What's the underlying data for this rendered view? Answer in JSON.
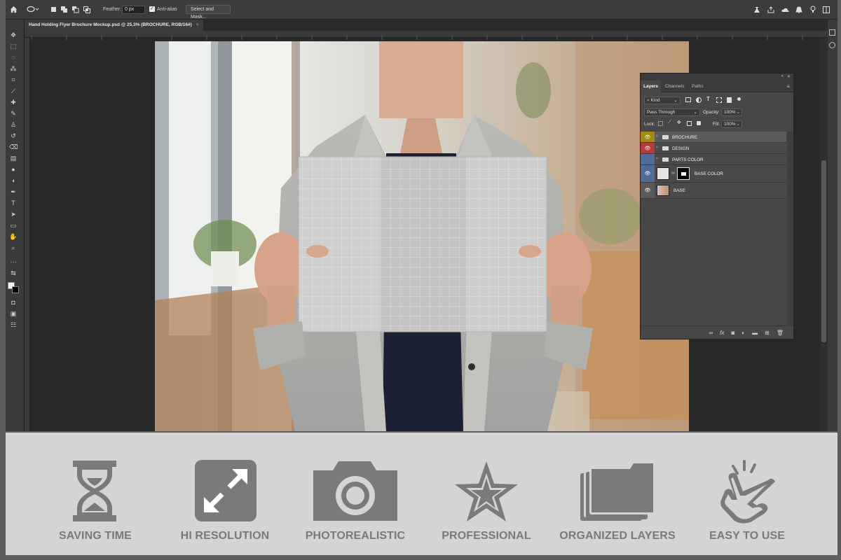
{
  "options_bar": {
    "feather_label": "Feather:",
    "feather_value": "0 px",
    "antialias_label": "Anti-alias",
    "select_mask_label": "Select and Mask..."
  },
  "document_tab": {
    "title": "Hand Holding Flyer Brochure Mockup.psd @ 25,3% (BROCHURE, RGB/16#)",
    "close": "×"
  },
  "layers_panel": {
    "tabs": [
      "Layers",
      "Channels",
      "Paths"
    ],
    "filter_kind": "Kind",
    "blend_mode": "Pass Through",
    "opacity_label": "Opacity:",
    "opacity_value": "100%",
    "lock_label": "Lock:",
    "fill_label": "Fill:",
    "fill_value": "100%",
    "layers": [
      {
        "name": "BROCHURE",
        "type": "group",
        "color": "#a08a14"
      },
      {
        "name": "DESIGN",
        "type": "group",
        "color": "#b33b3b"
      },
      {
        "name": "PARTS COLOR",
        "type": "group",
        "color": "#4f6b96"
      },
      {
        "name": "BASE COLOR",
        "type": "layer",
        "color": "#4f6b96"
      },
      {
        "name": "BASE",
        "type": "layer",
        "color": "#5a5a5a"
      }
    ],
    "footer_icons": [
      "link-icon",
      "fx-icon",
      "mask-icon",
      "adjustment-icon",
      "group-icon",
      "new-layer-icon",
      "trash-icon"
    ]
  },
  "features": [
    {
      "label": "SAVING TIME",
      "icon": "hourglass-icon"
    },
    {
      "label": "HI RESOLUTION",
      "icon": "expand-icon"
    },
    {
      "label": "PHOTOREALISTIC",
      "icon": "camera-icon"
    },
    {
      "label": "PROFESSIONAL",
      "icon": "star-icon"
    },
    {
      "label": "ORGANIZED LAYERS",
      "icon": "folders-icon"
    },
    {
      "label": "EASY TO USE",
      "icon": "hand-click-icon"
    }
  ],
  "colors": {
    "feature_icon": "#7a7a7a",
    "feature_strip_bg": "#d4d4d4",
    "app_bg": "#282828",
    "panel_bg": "#474747"
  }
}
